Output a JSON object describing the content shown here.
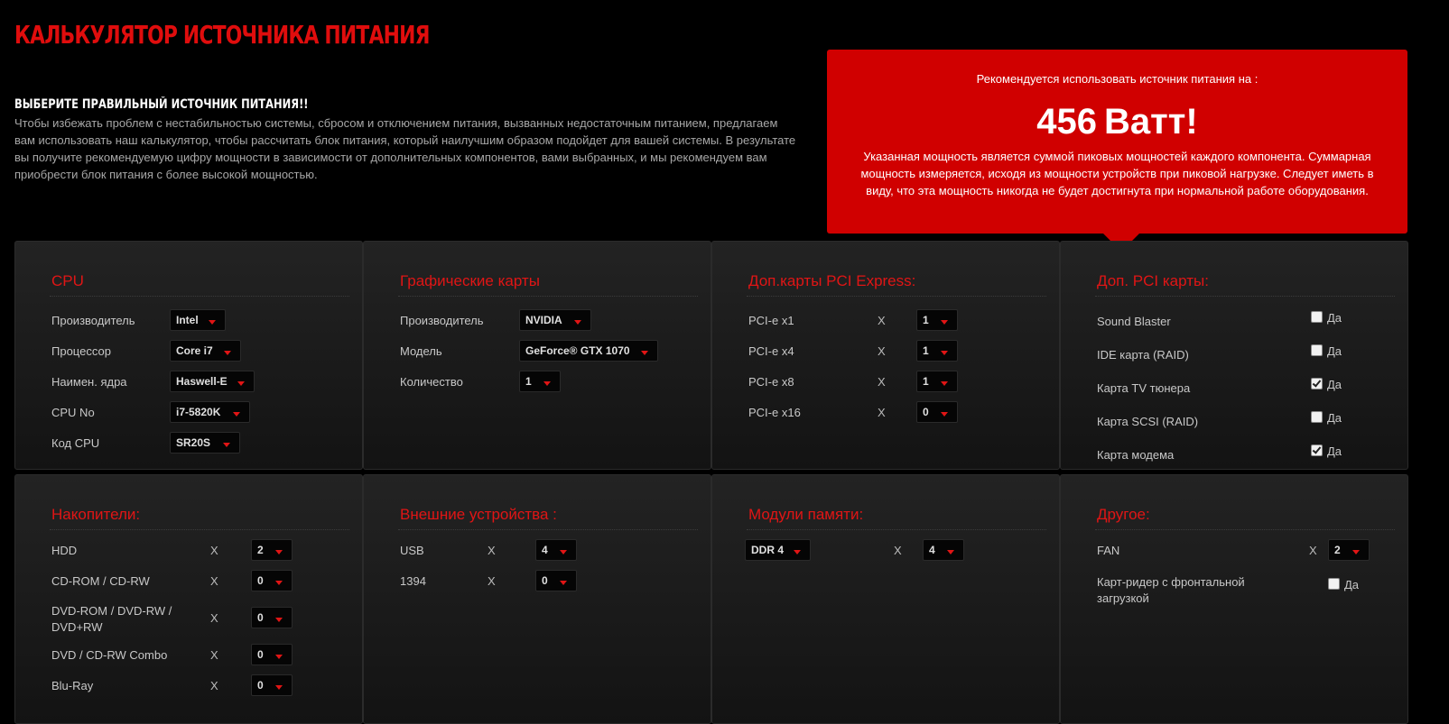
{
  "header": {
    "title": "КАЛЬКУЛЯТОР ИСТОЧНИКА ПИТАНИЯ",
    "subtitle": "ВЫБЕРИТЕ ПРАВИЛЬНЫЙ ИСТОЧНИК ПИТАНИЯ!!",
    "description": "Чтобы избежать проблем с нестабильностью системы, сбросом и отключением питания, вызванных недостаточным питанием, предлагаем вам использовать наш калькулятор, чтобы рассчитать блок питания, который наилучшим образом подойдет для вашей системы. В результате вы получите рекомендуемую цифру мощности в зависимости от дополнительных компонентов, вами выбранных, и мы рекомендуем вам приобрести блок питания с более высокой мощностью."
  },
  "recommendation": {
    "label": "Рекомендуется использовать источник питания на :",
    "watts": "456",
    "unit": "Ватт!",
    "note": "Указанная мощность является суммой пиковых мощностей каждого компонента. Суммарная мощность измеряется, исходя из мощности устройств при пиковой нагрузке. Следует иметь в виду, что эта мощность никогда не будет достигнута при нормальной работе оборудования."
  },
  "cpu": {
    "title": "CPU",
    "rows": [
      {
        "label": "Производитель",
        "value": "Intel"
      },
      {
        "label": "Процессор",
        "value": "Core i7"
      },
      {
        "label": "Наимен. ядра",
        "value": "Haswell-E"
      },
      {
        "label": "CPU No",
        "value": "i7-5820K"
      },
      {
        "label": "Код CPU",
        "value": "SR20S"
      }
    ]
  },
  "gpu": {
    "title": "Графические карты",
    "rows": [
      {
        "label": "Производитель",
        "value": "NVIDIA"
      },
      {
        "label": "Модель",
        "value": "GeForce® GTX 1070"
      },
      {
        "label": "Количество",
        "value": "1"
      }
    ]
  },
  "pcie": {
    "title": "Доп.карты PCI Express:",
    "times": "X",
    "rows": [
      {
        "label": "PCI-e x1",
        "value": "1"
      },
      {
        "label": "PCI-e x4",
        "value": "1"
      },
      {
        "label": "PCI-e x8",
        "value": "1"
      },
      {
        "label": "PCI-e x16",
        "value": "0"
      }
    ]
  },
  "pci": {
    "title": "Доп. PCI карты:",
    "yes": "Да",
    "rows": [
      {
        "label": "Sound Blaster",
        "checked": false
      },
      {
        "label": "IDE карта (RAID)",
        "checked": false
      },
      {
        "label": "Карта TV тюнера",
        "checked": true
      },
      {
        "label": "Карта SCSI (RAID)",
        "checked": false
      },
      {
        "label": "Карта модема",
        "checked": true
      }
    ]
  },
  "storage": {
    "title": "Накопители:",
    "times": "X",
    "rows": [
      {
        "label": "HDD",
        "value": "2"
      },
      {
        "label": "CD-ROM / CD-RW",
        "value": "0"
      },
      {
        "label": "DVD-ROM / DVD-RW / DVD+RW",
        "value": "0"
      },
      {
        "label": "DVD / CD-RW Combo",
        "value": "0"
      },
      {
        "label": "Blu-Ray",
        "value": "0"
      }
    ]
  },
  "external": {
    "title": "Внешние устройства :",
    "times": "X",
    "rows": [
      {
        "label": "USB",
        "value": "4"
      },
      {
        "label": "1394",
        "value": "0"
      }
    ]
  },
  "memory": {
    "title": "Модули памяти:",
    "times": "X",
    "type": "DDR 4",
    "count": "4"
  },
  "other": {
    "title": "Другое:",
    "times": "X",
    "yes": "Да",
    "fan_label": "FAN",
    "fan_value": "2",
    "reader_label": "Карт-ридер с фронтальной загрузкой",
    "reader_checked": false
  },
  "colors": {
    "accent": "#e01515",
    "recommendation_bg": "#d00000",
    "background": "#000000"
  }
}
